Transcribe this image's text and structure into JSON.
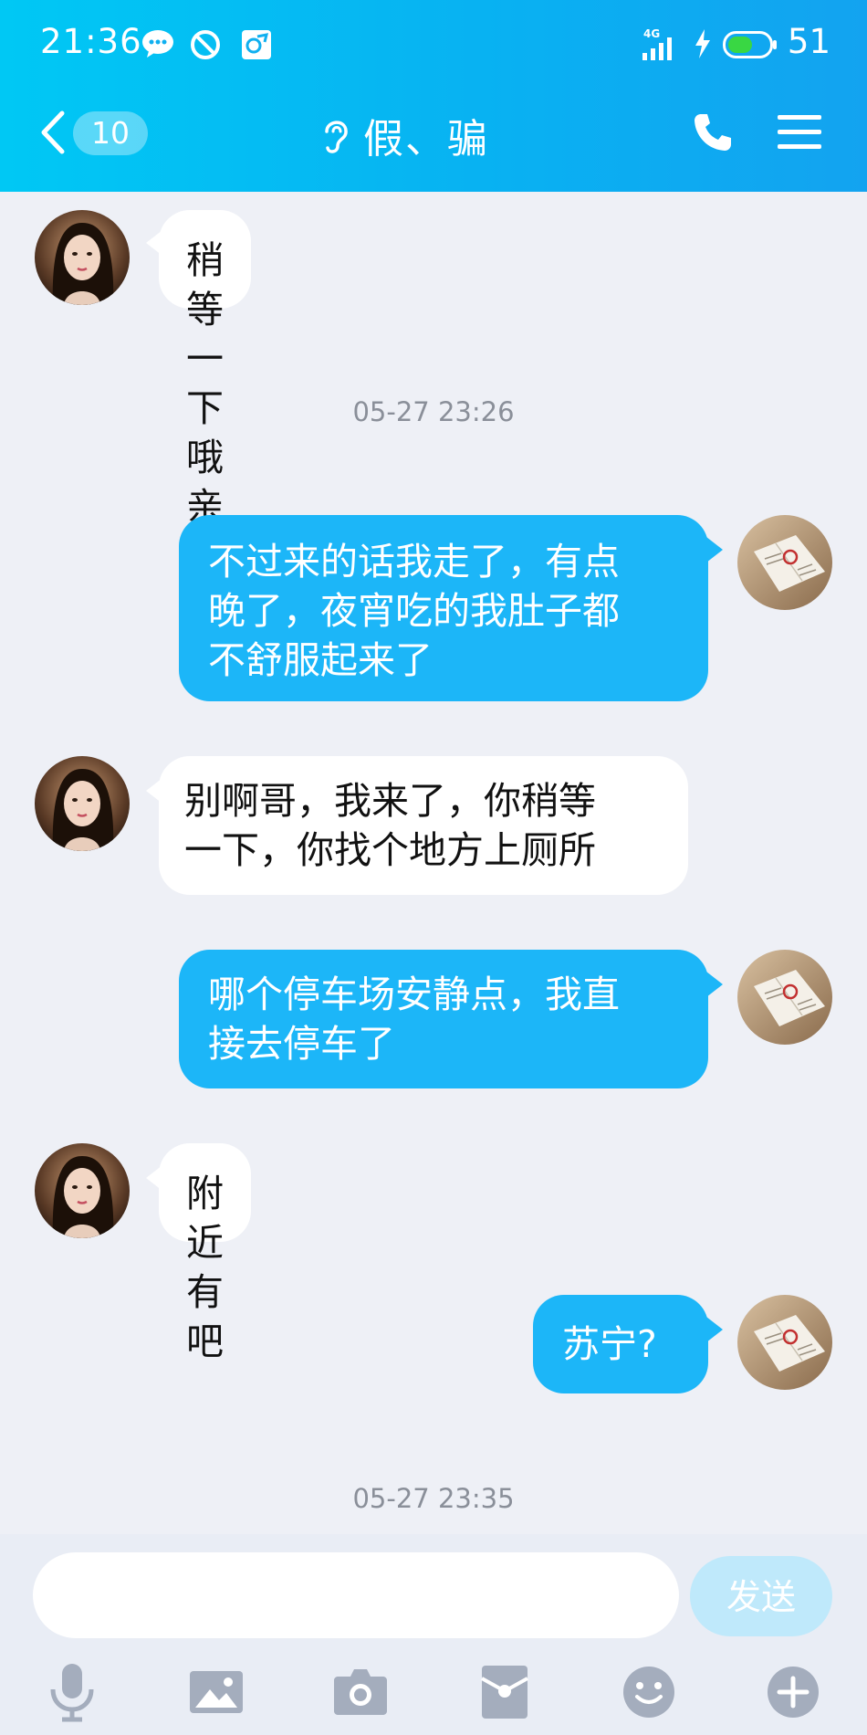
{
  "status_bar": {
    "time": "21:36",
    "network": "4G",
    "battery": "51"
  },
  "nav": {
    "back_count": "10",
    "title": "假、骗"
  },
  "messages": [
    {
      "direction": "in",
      "text": "稍等一下哦亲"
    },
    {
      "type": "timestamp",
      "text": "05-27 23:26"
    },
    {
      "direction": "out",
      "lines": [
        "不过来的话我走了，有点",
        "晚了，夜宵吃的我肚子都",
        "不舒服起来了"
      ]
    },
    {
      "direction": "in",
      "lines": [
        "别啊哥，我来了，你稍等",
        "一下，你找个地方上厕所"
      ]
    },
    {
      "direction": "out",
      "lines": [
        "哪个停车场安静点，我直",
        "接去停车了"
      ]
    },
    {
      "direction": "in",
      "text": "附近有吧"
    },
    {
      "direction": "out",
      "text": "苏宁?"
    },
    {
      "type": "timestamp",
      "text": "05-27 23:35"
    }
  ],
  "input": {
    "value": "",
    "placeholder": "",
    "send_label": "发送"
  },
  "toolbar": [
    "microphone-icon",
    "image-icon",
    "camera-icon",
    "red-packet-icon",
    "emoji-icon",
    "plus-icon"
  ],
  "colors": {
    "header": "#08b2f2",
    "outgoing_bubble": "#1cb6f8",
    "incoming_bubble": "#ffffff",
    "background": "#eef0f6"
  }
}
